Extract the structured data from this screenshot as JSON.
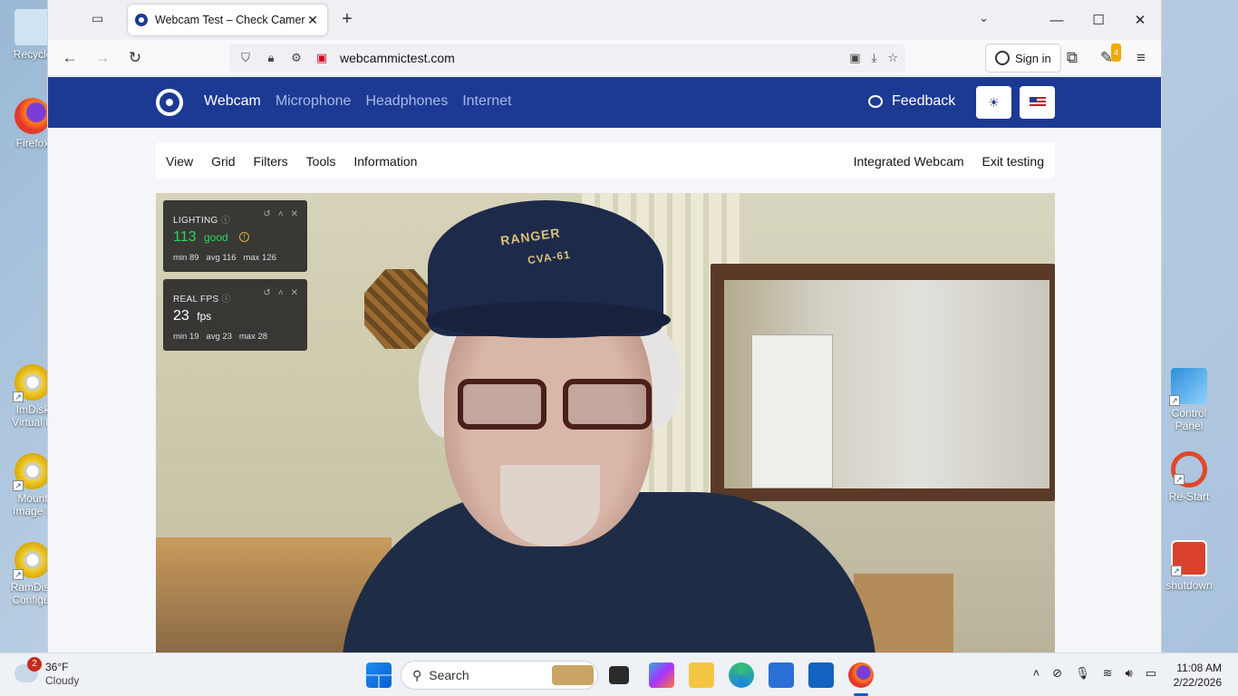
{
  "desktop": {
    "icons": [
      {
        "label": "Recycle"
      },
      {
        "label": "Firefox"
      },
      {
        "label": "ImDisk Virtual D"
      },
      {
        "label": "Mount Image F"
      },
      {
        "label": "RamDisk Configur"
      },
      {
        "label": "Control Panel"
      },
      {
        "label": "Re-Start"
      },
      {
        "label": "shutdown"
      }
    ]
  },
  "browser": {
    "tab": {
      "title": "Webcam Test – Check Camera Online",
      "close": "✕"
    },
    "new_tab": "+",
    "url": "webcammictest.com",
    "sign_in": "Sign in",
    "extension_badge": "4"
  },
  "site": {
    "nav": [
      "Webcam",
      "Microphone",
      "Headphones",
      "Internet"
    ],
    "feedback": "Feedback",
    "toolbar_left": [
      "View",
      "Grid",
      "Filters",
      "Tools",
      "Information"
    ],
    "toolbar_right": [
      "Integrated Webcam",
      "Exit testing"
    ],
    "video": {
      "cap_line1": "RANGER",
      "cap_line2": "CVA-61"
    },
    "panels": [
      {
        "title": "LIGHTING",
        "value": "113",
        "status": "good",
        "stats": "min 89   avg 116   max 126"
      },
      {
        "title": "REAL FPS",
        "value": "23",
        "unit": "fps",
        "stats": "min 19   avg 23   max 28"
      }
    ]
  },
  "taskbar": {
    "weather_temp": "36°F",
    "weather_desc": "Cloudy",
    "weather_badge": "2",
    "search": "Search",
    "time": "11:08 AM",
    "date": "2/22/2026"
  }
}
